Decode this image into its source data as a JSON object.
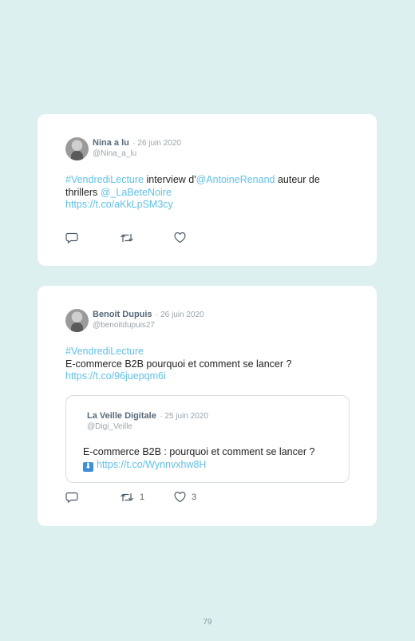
{
  "tweet1": {
    "name": "Nina a lu",
    "date": "· 26 juin 2020",
    "handle": "@Nina_a_lu",
    "hashtag": "#VendrediLecture",
    "t1": " interview d'",
    "mention1": "@AntoineRenand",
    "t2": " auteur de thrillers ",
    "mention2": "@_LaBeteNoire",
    "url": "https://t.co/aKkLpSM3cy"
  },
  "tweet2": {
    "name": "Benoit Dupuis",
    "date": "· 26 juin 2020",
    "handle": "@benoitdupuis27",
    "hashtag": "#VendrediLecture",
    "line2": "E-commerce B2B pourquoi et comment se lancer ?",
    "url": "https://t.co/96juepqm6i",
    "retweets": "1",
    "likes": "3",
    "quoted": {
      "name": "La Veille Digitale",
      "date": "· 25 juin 2020",
      "handle": "@Digi_Veille",
      "text": "E-commerce B2B : pourquoi et comment se lancer ?",
      "arrow": "⬇",
      "url": "https://t.co/Wynnvxhw8H"
    }
  },
  "icons": [
    "reply-icon",
    "retweet-icon",
    "like-icon"
  ],
  "colors": {
    "background": "#dcf0ef",
    "link": "#5ec0ea",
    "name": "#556a7a"
  },
  "page_number": "79"
}
